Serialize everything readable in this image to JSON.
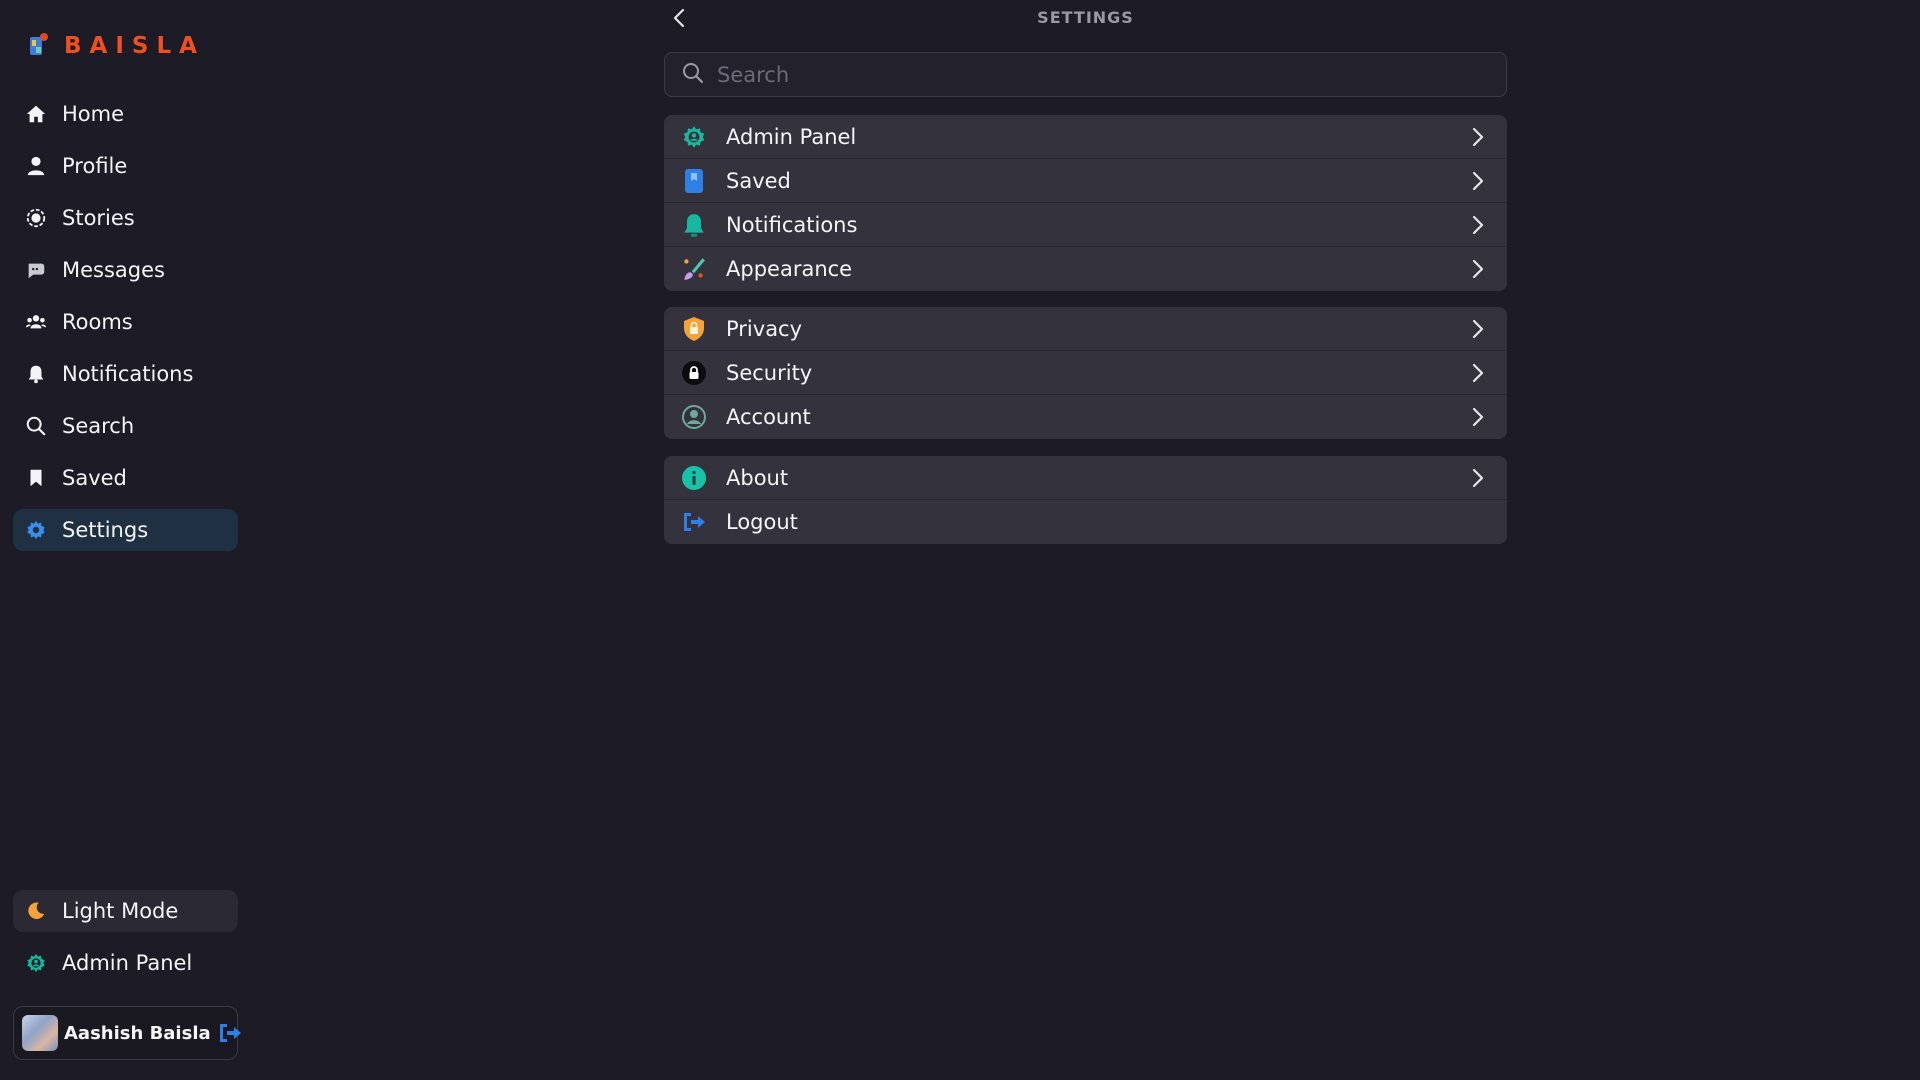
{
  "brand": {
    "name": "BAISLA",
    "color": "#f0501f"
  },
  "sidebar": {
    "items": [
      {
        "label": "Home",
        "icon": "home-icon"
      },
      {
        "label": "Profile",
        "icon": "user-icon"
      },
      {
        "label": "Stories",
        "icon": "stories-icon"
      },
      {
        "label": "Messages",
        "icon": "chat-icon"
      },
      {
        "label": "Rooms",
        "icon": "group-icon"
      },
      {
        "label": "Notifications",
        "icon": "bell-icon"
      },
      {
        "label": "Search",
        "icon": "search-icon"
      },
      {
        "label": "Saved",
        "icon": "bookmark-icon"
      },
      {
        "label": "Settings",
        "icon": "gear-icon",
        "active": true
      }
    ],
    "light_mode_label": "Light Mode",
    "admin_panel_label": "Admin Panel",
    "user_name": "Aashish Baisla"
  },
  "settings": {
    "title": "SETTINGS",
    "search_placeholder": "Search",
    "group1": [
      {
        "label": "Admin Panel",
        "icon": "admin-gear-icon"
      },
      {
        "label": "Saved",
        "icon": "bookmark-icon"
      },
      {
        "label": "Notifications",
        "icon": "bell-icon"
      },
      {
        "label": "Appearance",
        "icon": "paint-brush-icon"
      }
    ],
    "group2": [
      {
        "label": "Privacy",
        "icon": "shield-icon"
      },
      {
        "label": "Security",
        "icon": "lock-icon"
      },
      {
        "label": "Account",
        "icon": "account-icon"
      }
    ],
    "group3": [
      {
        "label": "About",
        "icon": "info-icon"
      },
      {
        "label": "Logout",
        "icon": "logout-icon"
      }
    ]
  },
  "colors": {
    "background": "#1d1c26",
    "active_nav": "#1f3042",
    "row_background": "#34333d",
    "accent_blue": "#2f7fe8",
    "accent_teal": "#16b8a0"
  }
}
